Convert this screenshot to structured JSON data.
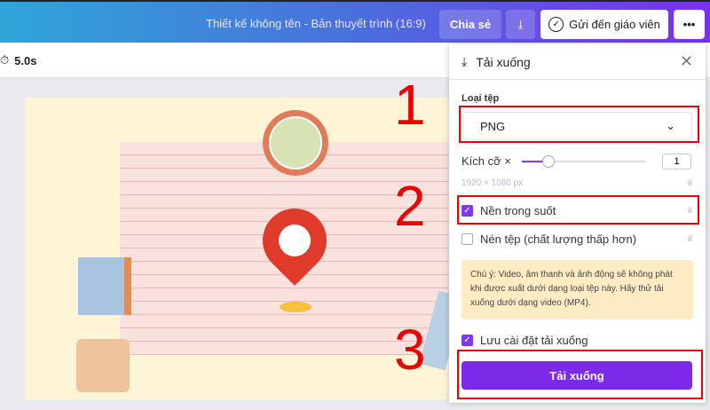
{
  "header": {
    "title": "Thiết kế không tên - Bản thuyết trình (16:9)",
    "share_label": "Chia sẻ",
    "send_label": "Gửi đến giáo viên",
    "more_label": "•••"
  },
  "timer": {
    "value": "5.0s"
  },
  "annotations": [
    "1",
    "2",
    "3"
  ],
  "panel": {
    "title": "Tải xuống",
    "file_type_label": "Loại tệp",
    "file_type_value": "PNG",
    "size_label": "Kích cỡ ×",
    "size_value": "1",
    "size_slider_fraction": 0.1,
    "dimensions": "1920 × 1080 px",
    "transparent_bg": {
      "label": "Nền trong suốt",
      "checked": true
    },
    "compress": {
      "label": "Nén tệp (chất lượng thấp hơn)",
      "checked": false
    },
    "note": "Chú ý: Video, âm thanh và ảnh động sẽ không phát khi được xuất dưới dạng loại tệp này. Hãy thử tải xuống dưới dạng video (MP4).",
    "save_settings": {
      "label": "Lưu cài đặt tải xuống",
      "checked": true
    },
    "download_label": "Tải xuống"
  }
}
